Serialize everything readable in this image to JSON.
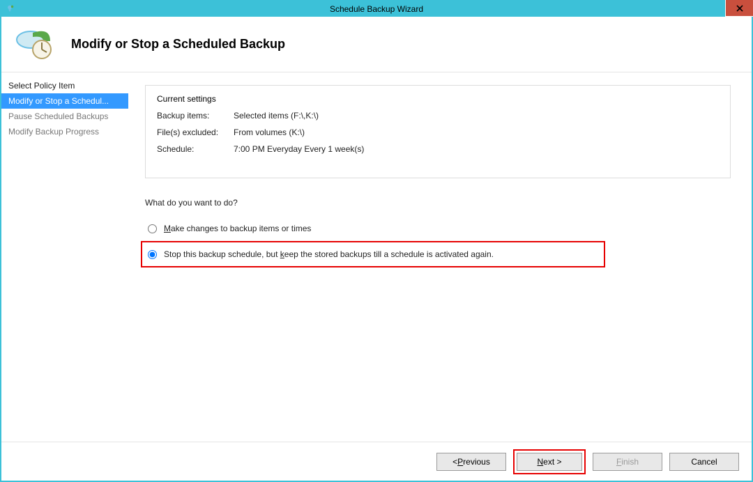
{
  "window": {
    "title": "Schedule Backup Wizard"
  },
  "header": {
    "page_title": "Modify or Stop a Scheduled Backup"
  },
  "sidebar": {
    "items": [
      {
        "label": "Select Policy Item",
        "selected": false,
        "dim": false
      },
      {
        "label": "Modify or Stop a Schedul...",
        "selected": true,
        "dim": false
      },
      {
        "label": "Pause Scheduled Backups",
        "selected": false,
        "dim": true
      },
      {
        "label": "Modify Backup Progress",
        "selected": false,
        "dim": true
      }
    ]
  },
  "current_settings": {
    "legend": "Current settings",
    "rows": [
      {
        "label": "Backup items:",
        "value": "Selected items (F:\\,K:\\)"
      },
      {
        "label": "File(s) excluded:",
        "value": "From volumes (K:\\)"
      },
      {
        "label": "Schedule:",
        "value": "7:00 PM Everyday Every 1 week(s)"
      }
    ]
  },
  "question": "What do you want to do?",
  "options": {
    "make_changes": {
      "prefix": "",
      "underline": "M",
      "rest": "ake changes to backup items or times",
      "checked": false
    },
    "stop_schedule": {
      "prefix": "Stop this backup schedule, but ",
      "underline": "k",
      "rest": "eep the stored backups till a schedule is activated again.",
      "checked": true
    }
  },
  "buttons": {
    "previous": {
      "prefix": "< ",
      "underline": "P",
      "rest": "revious"
    },
    "next": {
      "prefix": "",
      "underline": "N",
      "rest": "ext >"
    },
    "finish": {
      "prefix": "",
      "underline": "F",
      "rest": "inish"
    },
    "cancel": {
      "label": "Cancel"
    }
  }
}
